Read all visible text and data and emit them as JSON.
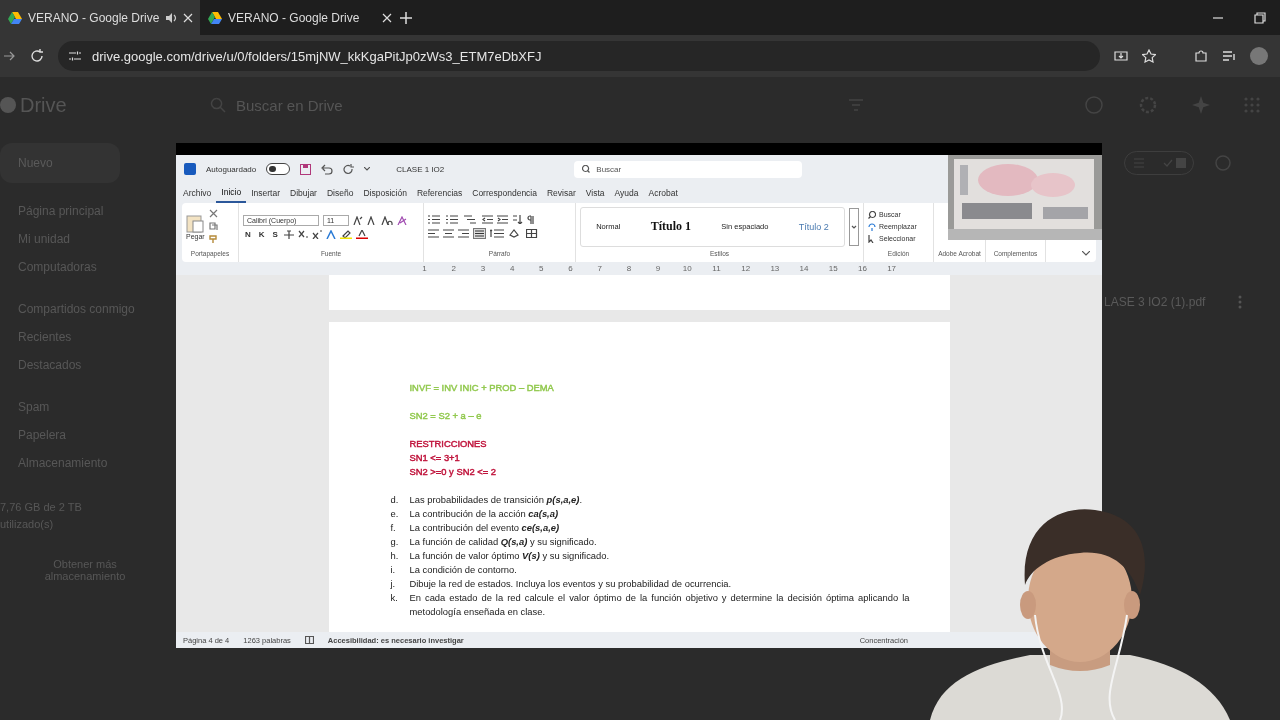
{
  "browser": {
    "tabs": [
      {
        "title": "VERANO - Google Drive",
        "selected": true,
        "audio": true
      },
      {
        "title": "VERANO - Google Drive",
        "selected": false,
        "audio": false
      }
    ],
    "url": "drive.google.com/drive/u/0/folders/15mjNW_kkKgaPitJp0zWs3_ETM7eDbXFJ"
  },
  "drive": {
    "logo": "Drive",
    "search": {
      "placeholder": "Buscar en Drive"
    },
    "new_button": "Nuevo",
    "nav": [
      [
        "Página principal",
        "Mi unidad",
        "Computadoras"
      ],
      [
        "Compartidos conmigo",
        "Recientes",
        "Destacados"
      ],
      [
        "Spam",
        "Papelera",
        "Almacenamiento"
      ]
    ],
    "storage": "7,76 GB de 2 TB utilizado(s)",
    "storage_button": "Obtener más almacenamiento",
    "file": "LASE 3 IO2 (1).pdf"
  },
  "word": {
    "autosave": {
      "label": "Autoguardado",
      "on": false
    },
    "doc_title": "CLASE 1 IO2",
    "search": {
      "placeholder": "Buscar"
    },
    "menu": [
      {
        "label": "Archivo",
        "selected": false
      },
      {
        "label": "Inicio",
        "selected": true
      },
      {
        "label": "Insertar",
        "selected": false
      },
      {
        "label": "Dibujar",
        "selected": false
      },
      {
        "label": "Diseño",
        "selected": false
      },
      {
        "label": "Disposición",
        "selected": false
      },
      {
        "label": "Referencias",
        "selected": false
      },
      {
        "label": "Correspondencia",
        "selected": false
      },
      {
        "label": "Revisar",
        "selected": false
      },
      {
        "label": "Vista",
        "selected": false
      },
      {
        "label": "Ayuda",
        "selected": false
      },
      {
        "label": "Acrobat",
        "selected": false
      }
    ],
    "ribbon": {
      "paste": "Pegar",
      "font": "Calibri (Cuerpo)",
      "size": "11",
      "format_buttons": [
        "N",
        "K",
        "S"
      ],
      "styles": [
        {
          "label": "Normal",
          "kind": "normal"
        },
        {
          "label": "Título 1",
          "kind": "heading1"
        },
        {
          "label": "Sin espaciado",
          "kind": "plain"
        },
        {
          "label": "Título 2",
          "kind": "heading2"
        }
      ],
      "editing": [
        "Buscar",
        "Reemplazar",
        "Seleccionar"
      ],
      "groups": [
        "Portapapeles",
        "Fuente",
        "Párrafo",
        "Estilos",
        "Edición",
        "Adobe Acrobat",
        "Complementos"
      ]
    },
    "ruler": [
      "1",
      "2",
      "3",
      "4",
      "5",
      "6",
      "7",
      "8",
      "9",
      "10",
      "11",
      "12",
      "13",
      "14",
      "15",
      "16",
      "17"
    ],
    "paragraphs": [
      {
        "color": "#92c94f",
        "lines": [
          "INVF = INV INIC + PROD – DEMA"
        ]
      },
      {
        "color": "#92c94f",
        "lines": [
          "SN2 = S2 + a – e"
        ]
      },
      {
        "color": "#c0143c",
        "lines": [
          "RESTRICCIONES",
          "SN1 <= 3+1",
          "SN2 >=0 y SN2 <= 2"
        ]
      }
    ],
    "list": [
      {
        "marker": "d.",
        "text": "Las probabilidades de transición **p(s,a,e)**."
      },
      {
        "marker": "e.",
        "text": "La contribución de la acción **ca(s,a)**"
      },
      {
        "marker": "f.",
        "text": "La contribución del evento **ce(s,a,e)**"
      },
      {
        "marker": "g.",
        "text": "La función de calidad **Q(s,a)** y su significado."
      },
      {
        "marker": "h.",
        "text": "La función de valor óptimo **V(s)** y su significado."
      },
      {
        "marker": "i.",
        "text": "La condición de contorno."
      },
      {
        "marker": "j.",
        "text": "Dibuje la red de estados. Incluya los eventos y su probabilidad de ocurrencia."
      },
      {
        "marker": "k.",
        "text": "En cada estado de la red calcule el valor óptimo de la función objetivo y determine la decisión óptima aplicando la metodología enseñada en clase."
      }
    ],
    "status": {
      "page": "Página 4 de 4",
      "words": "1263 palabras",
      "accessibility": "Accesibilidad: es necesario investigar",
      "focus": "Concentración"
    }
  }
}
